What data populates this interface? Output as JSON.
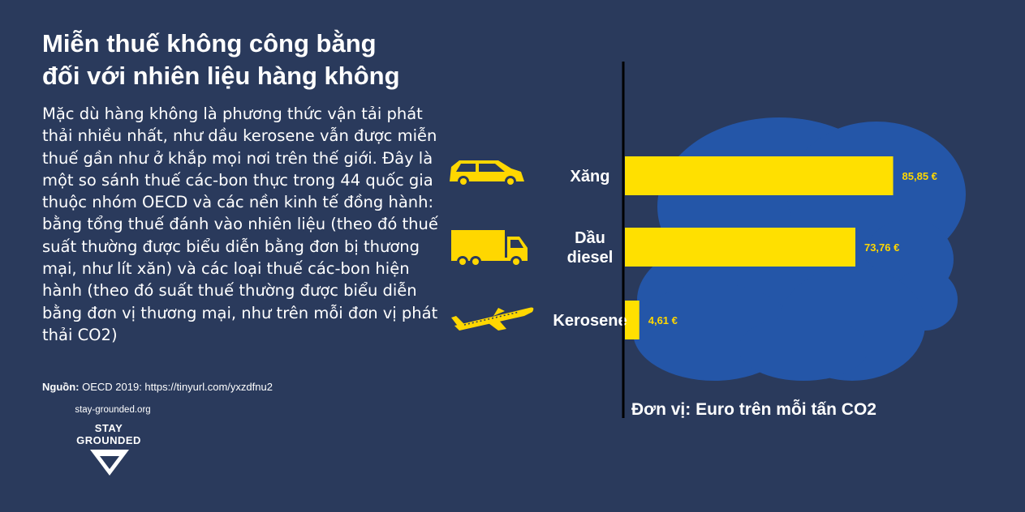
{
  "header": {
    "title_line1": "Miễn thuế không công bằng",
    "title_line2": "đối với nhiên liệu hàng không"
  },
  "description": "Mặc dù hàng không là phương thức vận tải phát thải nhiều nhất, như dầu kerosene vẫn được miễn thuế gần như ở khắp mọi nơi trên thế giới. Đây là một so sánh thuế các-bon thực trong 44 quốc gia thuộc nhóm OECD và các nền kinh tế đồng hành: bằng tổng thuế đánh vào nhiên liệu (theo đó thuế suất thường được biểu diễn bằng đơn bị thương mại, như lít xăn) và các loại thuế các-bon hiện hành (theo đó suất thuế thường được biểu diễn bằng đơn vị thương mại, như trên mỗi đơn vị phát thải CO2)",
  "source": {
    "label": "Nguồn:",
    "text": "OECD 2019: https://tinyurl.com/yxzdfnu2"
  },
  "logo": {
    "url": "stay-grounded.org",
    "line1": "STAY",
    "line2": "GROUNDED"
  },
  "colors": {
    "background": "#2a3a5c",
    "bar": "#ffe000",
    "cloud": "#2456a8",
    "value_text": "#ffd700",
    "icon": "#ffd700"
  },
  "icons": [
    "car-icon",
    "truck-icon",
    "airplane-icon"
  ],
  "chart_data": {
    "type": "bar",
    "orientation": "horizontal",
    "categories": [
      [
        "Xăng"
      ],
      [
        "Dầu",
        "diesel"
      ],
      [
        "Kerosene"
      ]
    ],
    "values": [
      85.85,
      73.76,
      4.61
    ],
    "value_labels": [
      "85,85 €",
      "73,76 €",
      "4,61 €"
    ],
    "xlim": [
      0,
      100
    ],
    "unit_label": "Đơn vị: Euro trên mỗi tấn CO2",
    "grid": false,
    "legend": "none"
  }
}
